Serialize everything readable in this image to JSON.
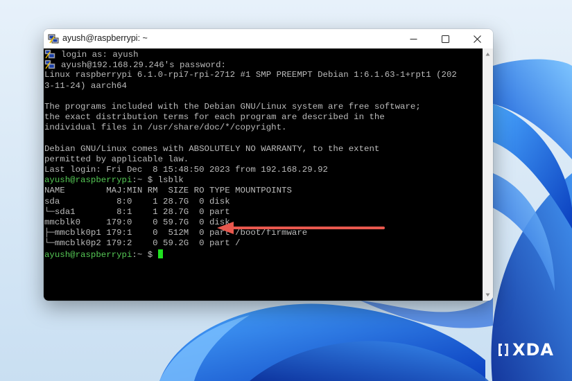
{
  "window": {
    "title": "ayush@raspberrypi: ~"
  },
  "terminal": {
    "lines": [
      "login as: ayush",
      "ayush@192.168.29.246's password:",
      "Linux raspberrypi 6.1.0-rpi7-rpi-2712 #1 SMP PREEMPT Debian 1:6.1.63-1+rpt1 (202",
      "3-11-24) aarch64",
      "",
      "The programs included with the Debian GNU/Linux system are free software;",
      "the exact distribution terms for each program are described in the",
      "individual files in /usr/share/doc/*/copyright.",
      "",
      "Debian GNU/Linux comes with ABSOLUTELY NO WARRANTY, to the extent",
      "permitted by applicable law.",
      "Last login: Fri Dec  8 15:48:50 2023 from 192.168.29.92"
    ],
    "prompt_host": "ayush@raspberrypi",
    "prompt_path": ":~ $ ",
    "command": "lsblk",
    "lsblk_header": "NAME        MAJ:MIN RM  SIZE RO TYPE MOUNTPOINTS",
    "lsblk_rows": [
      "sda           8:0    1 28.7G  0 disk",
      "└─sda1        8:1    1 28.7G  0 part",
      "mmcblk0     179:0    0 59.7G  0 disk",
      "├─mmcblk0p1 179:1    0  512M  0 part /boot/firmware",
      "└─mmcblk0p2 179:2    0 59.2G  0 part /"
    ]
  },
  "logo": {
    "text": "XDA"
  },
  "colors": {
    "arrow": "#e8584e",
    "prompt": "#55c855",
    "cursor": "#20e020",
    "terminal_bg": "#000000",
    "terminal_fg": "#bbbbbb"
  }
}
